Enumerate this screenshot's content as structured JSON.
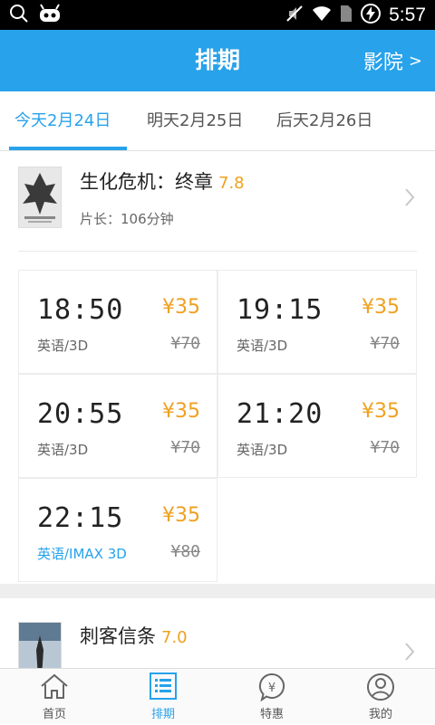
{
  "status_bar": {
    "time": "5:57"
  },
  "header": {
    "title": "排期",
    "cinema_link": "影院",
    "cinema_arrow": ">"
  },
  "tabs": [
    {
      "label": "今天2月24日"
    },
    {
      "label": "明天2月25日"
    },
    {
      "label": "后天2月26日"
    }
  ],
  "movies": [
    {
      "title": "生化危机：终章",
      "rating": "7.8",
      "duration": "片长：106分钟",
      "showtimes": [
        {
          "time": "18:50",
          "price": "¥35",
          "format": "英语/3D",
          "original_price": "¥70"
        },
        {
          "time": "19:15",
          "price": "¥35",
          "format": "英语/3D",
          "original_price": "¥70"
        },
        {
          "time": "20:55",
          "price": "¥35",
          "format": "英语/3D",
          "original_price": "¥70"
        },
        {
          "time": "21:20",
          "price": "¥35",
          "format": "英语/3D",
          "original_price": "¥70"
        },
        {
          "time": "22:15",
          "price": "¥35",
          "format": "英语/IMAX 3D",
          "original_price": "¥80"
        }
      ]
    },
    {
      "title": "刺客信条",
      "rating": "7.0"
    }
  ],
  "bottom_nav": [
    {
      "label": "首页",
      "icon": "home-icon"
    },
    {
      "label": "排期",
      "icon": "schedule-list-icon",
      "active": true
    },
    {
      "label": "特惠",
      "icon": "yen-badge-icon"
    },
    {
      "label": "我的",
      "icon": "user-icon"
    }
  ],
  "colors": {
    "accent": "#27a2eb",
    "price": "#f0a020",
    "rating": "#f0a020"
  }
}
